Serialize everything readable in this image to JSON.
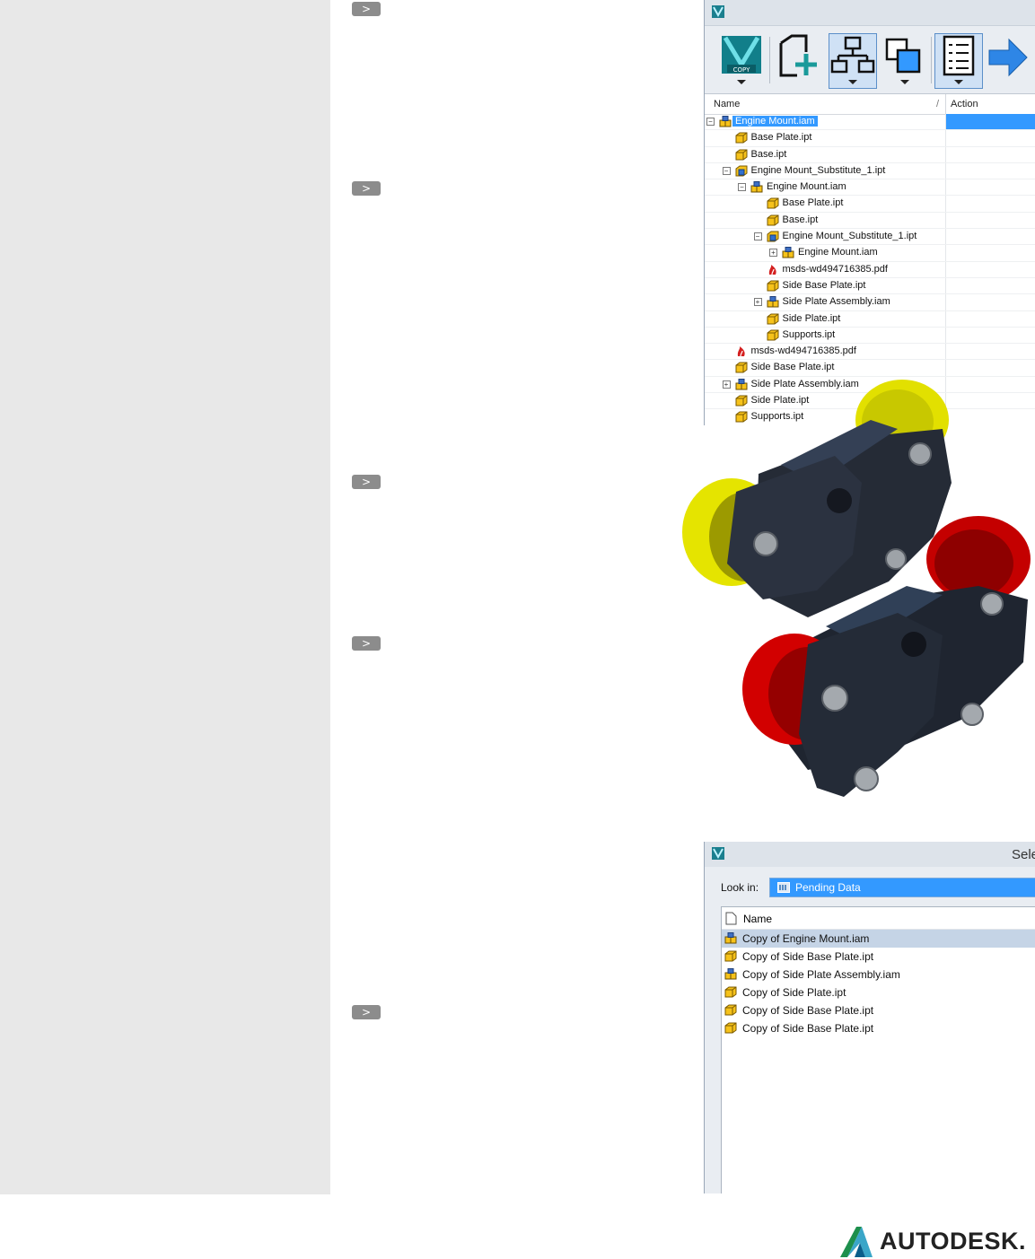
{
  "copy_design": {
    "toolbar": {
      "copy_label": "COPY",
      "buttons": [
        "copy-icon",
        "new-file-icon",
        "assembly-tree-icon",
        "replace-icon",
        "list-view-icon",
        "arrow-right-icon"
      ]
    },
    "columns": {
      "name": "Name",
      "sort": "/",
      "action": "Action"
    },
    "rows": [
      {
        "label": "Engine Mount.iam",
        "type": "iam",
        "level": 0,
        "toggle": "minus",
        "selected": true
      },
      {
        "label": "Base Plate.ipt",
        "type": "ipt",
        "level": 1
      },
      {
        "label": "Base.ipt",
        "type": "ipt",
        "level": 1
      },
      {
        "label": "Engine Mount_Substitute_1.ipt",
        "type": "sub",
        "level": 1,
        "toggle": "minus"
      },
      {
        "label": "Engine Mount.iam",
        "type": "iam",
        "level": 2,
        "toggle": "minus"
      },
      {
        "label": "Base Plate.ipt",
        "type": "ipt",
        "level": 3
      },
      {
        "label": "Base.ipt",
        "type": "ipt",
        "level": 3
      },
      {
        "label": "Engine Mount_Substitute_1.ipt",
        "type": "sub",
        "level": 3,
        "toggle": "minus"
      },
      {
        "label": "Engine Mount.iam",
        "type": "iam",
        "level": 4,
        "toggle": "plus"
      },
      {
        "label": "msds-wd494716385.pdf",
        "type": "pdf",
        "level": 3
      },
      {
        "label": "Side Base Plate.ipt",
        "type": "ipt",
        "level": 3
      },
      {
        "label": "Side Plate Assembly.iam",
        "type": "iam",
        "level": 3,
        "toggle": "plus"
      },
      {
        "label": "Side Plate.ipt",
        "type": "ipt",
        "level": 3
      },
      {
        "label": "Supports.ipt",
        "type": "ipt",
        "level": 3
      },
      {
        "label": "msds-wd494716385.pdf",
        "type": "pdf",
        "level": 1
      },
      {
        "label": "Side Base Plate.ipt",
        "type": "ipt",
        "level": 1
      },
      {
        "label": "Side Plate Assembly.iam",
        "type": "iam",
        "level": 1,
        "toggle": "plus"
      },
      {
        "label": "Side Plate.ipt",
        "type": "ipt",
        "level": 1
      },
      {
        "label": "Supports.ipt",
        "type": "ipt",
        "level": 1
      }
    ]
  },
  "select_dialog": {
    "title": "Sele",
    "look_in_label": "Look in:",
    "look_in_value": "Pending Data",
    "column_name": "Name",
    "files": [
      {
        "label": "Copy of Engine Mount.iam",
        "type": "iam",
        "selected": true
      },
      {
        "label": "Copy of Side Base Plate.ipt",
        "type": "ipt"
      },
      {
        "label": "Copy of Side Plate Assembly.iam",
        "type": "iam"
      },
      {
        "label": "Copy of Side Plate.ipt",
        "type": "ipt"
      },
      {
        "label": "Copy of Side Base Plate.ipt",
        "type": "ipt"
      },
      {
        "label": "Copy of Side Base Plate.ipt",
        "type": "ipt"
      }
    ]
  },
  "chevrons": [
    ">",
    ">",
    ">",
    ">",
    ">"
  ],
  "brand": {
    "name": "AUTODESK.",
    "accent": "#0696d7",
    "selection": "#3399ff"
  }
}
